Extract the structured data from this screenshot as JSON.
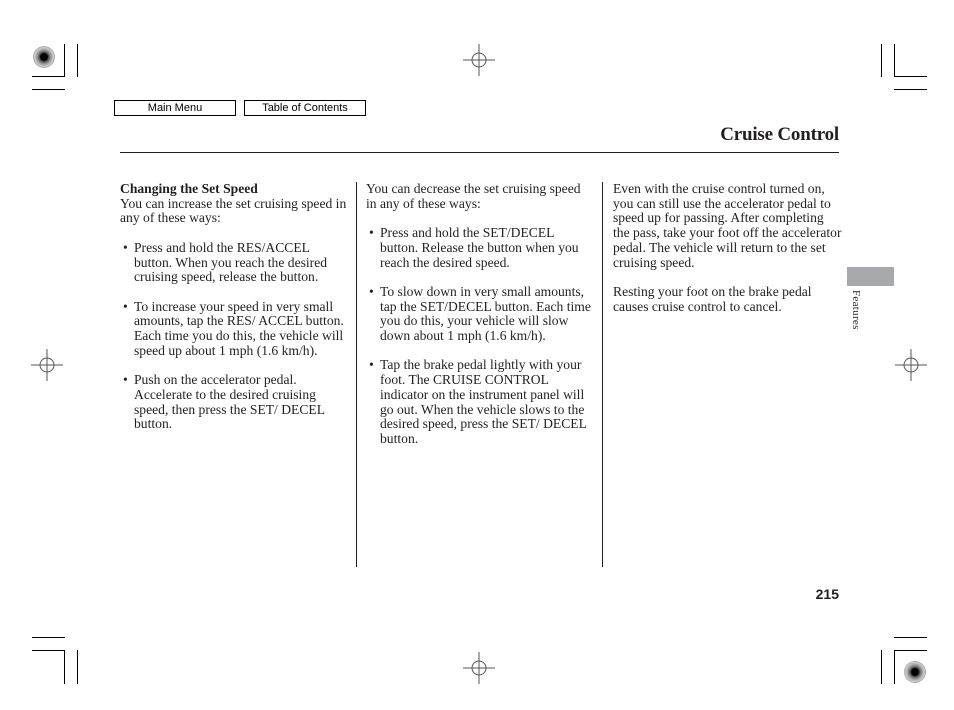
{
  "nav": {
    "main_menu": "Main Menu",
    "table_of_contents": "Table of Contents"
  },
  "header": {
    "title": "Cruise Control"
  },
  "column1": {
    "heading": "Changing the Set Speed",
    "intro": "You can increase the set cruising speed in any of these ways:",
    "bullets": [
      "Press and hold the RES/ACCEL button. When you reach the desired cruising speed, release the button.",
      "To increase your speed in very small amounts, tap the RES/ ACCEL button. Each time you do this, the vehicle will speed up about 1 mph (1.6 km/h).",
      "Push on the accelerator pedal. Accelerate to the desired cruising speed, then press the SET/ DECEL button."
    ]
  },
  "column2": {
    "intro": "You can decrease the set cruising speed in any of these ways:",
    "bullets": [
      "Press and hold the SET/DECEL button. Release the button when you reach the desired speed.",
      "To slow down in very small amounts, tap the SET/DECEL button. Each time you do this, your vehicle will slow down about 1 mph (1.6 km/h).",
      "Tap the brake pedal lightly with your foot. The CRUISE CONTROL indicator on the instrument panel will go out. When the vehicle slows to the desired speed, press the SET/ DECEL button."
    ]
  },
  "column3": {
    "paragraphs": [
      "Even with the cruise control turned on, you can still use the accelerator pedal to speed up for passing. After completing the pass, take your foot off the accelerator pedal. The vehicle will return to the set cruising speed.",
      "Resting your foot on the brake pedal causes cruise control to cancel."
    ]
  },
  "side_tab": {
    "label": "Features",
    "color": "#a7a9ac"
  },
  "footer": {
    "page_number": "215"
  },
  "bullet_glyph": "•"
}
